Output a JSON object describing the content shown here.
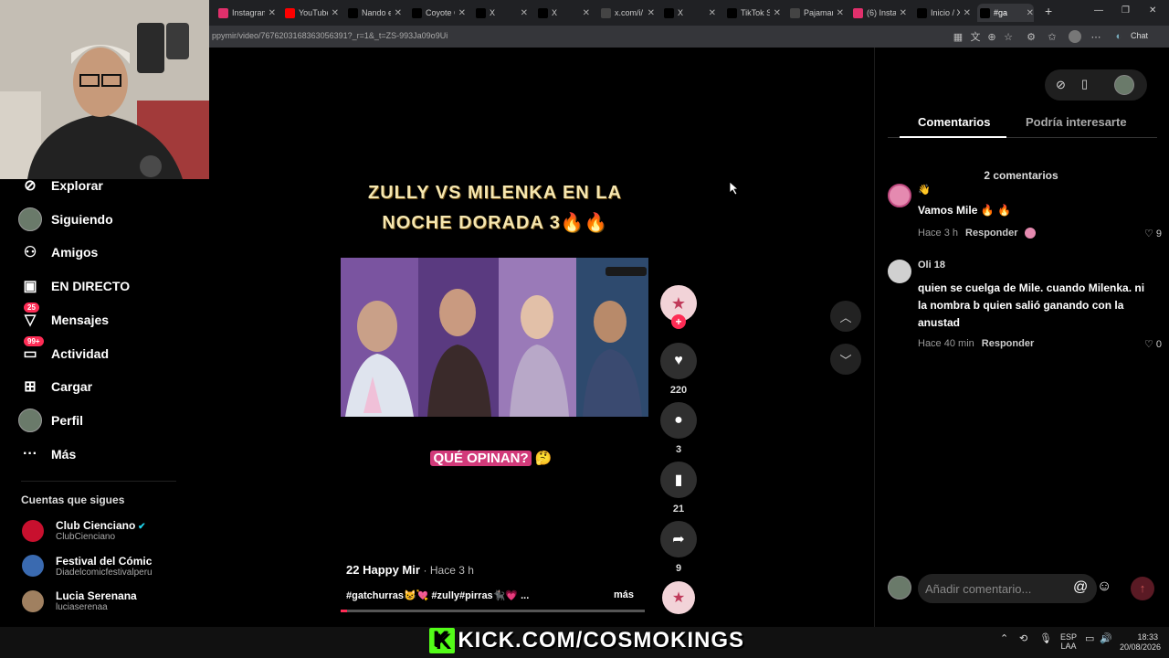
{
  "browser": {
    "tabs": [
      {
        "label": "Instagram",
        "color": "#e1306c",
        "icon": "instagram-icon"
      },
      {
        "label": "YouTube",
        "color": "#ff0000",
        "icon": "youtube-icon"
      },
      {
        "label": "Nando e",
        "color": "#000000",
        "icon": "x-icon"
      },
      {
        "label": "Coyote C",
        "color": "#000000",
        "icon": "x-icon"
      },
      {
        "label": "X",
        "color": "#000000",
        "icon": "x-icon"
      },
      {
        "label": "X",
        "color": "#000000",
        "icon": "x-icon"
      },
      {
        "label": "x.com/i/",
        "color": "#444444",
        "icon": "globe-icon"
      },
      {
        "label": "X",
        "color": "#000000",
        "icon": "x-icon"
      },
      {
        "label": "TikTok S",
        "color": "#000000",
        "icon": "tiktok-icon"
      },
      {
        "label": "Pajaman",
        "color": "#444444",
        "icon": "x-icon"
      },
      {
        "label": "(6) Insta",
        "color": "#e1306c",
        "icon": "instagram-icon"
      },
      {
        "label": "Inicio / X",
        "color": "#000000",
        "icon": "x-icon"
      },
      {
        "label": "#ga",
        "color": "#000000",
        "icon": "tiktok-icon"
      }
    ],
    "url": "ppymir/video/7676203168363056391?_r=1&_t=ZS-993Ja09o9Ui",
    "chat_label": "Chat"
  },
  "sidebar": {
    "items": [
      {
        "label": "Explorar",
        "icon": "compass-icon"
      },
      {
        "label": "Siguiendo",
        "icon": "following-avatar-icon"
      },
      {
        "label": "Amigos",
        "icon": "friends-icon"
      },
      {
        "label": "EN DIRECTO",
        "icon": "live-tv-icon"
      },
      {
        "label": "Mensajes",
        "icon": "messages-icon",
        "badge": "25"
      },
      {
        "label": "Actividad",
        "icon": "activity-icon",
        "badge": "99+"
      },
      {
        "label": "Cargar",
        "icon": "upload-icon"
      },
      {
        "label": "Perfil",
        "icon": "profile-avatar-icon"
      },
      {
        "label": "Más",
        "icon": "more-icon"
      }
    ],
    "following_title": "Cuentas que sigues",
    "accounts": [
      {
        "name": "Club Cienciano",
        "handle": "ClubCienciano",
        "verified": true
      },
      {
        "name": "Festival del Cómic",
        "handle": "Diadelcomicfestivalperu"
      },
      {
        "name": "Lucia Serenana",
        "handle": "luciaserenaa"
      }
    ]
  },
  "video": {
    "title": "ZULLY VS MILENKA EN LA NOCHE DORADA 3🔥🔥",
    "question": "QUÉ OPINAN?",
    "question_emoji": "🤔",
    "author": "22 Happy Mir",
    "time": "· Hace 3 h",
    "tags": "#gatchurras😺💘 #zully#pirras🐈‍⬛💗 ...",
    "more": "más",
    "likes": "220",
    "comments": "3",
    "saves": "21",
    "shares": "9",
    "progress": 0.02
  },
  "comments_panel": {
    "tab_comments": "Comentarios",
    "tab_suggested": "Podría interesarte",
    "count": "2 comentarios",
    "comments": [
      {
        "user": "👋",
        "text": "Vamos Mile 🔥 🔥",
        "time": "Hace 3 h",
        "reply": "Responder",
        "likes": "9"
      },
      {
        "user": "Oli 18",
        "text": "quien se cuelga de Mile. cuando Milenka. ni la nombra b quien salió ganando con la anustad",
        "time": "Hace 40 min",
        "reply": "Responder",
        "likes": "0"
      }
    ],
    "input_placeholder": "Añadir comentario..."
  },
  "overlay": {
    "kick_text": "KICK.COM/COSMOKINGS"
  },
  "taskbar": {
    "lang": "ESP",
    "lang2": "LAA",
    "time": "18:33",
    "date": "20/08/2026"
  },
  "colors": {
    "accent": "#fe2c55",
    "kick_green": "#53fc18"
  }
}
